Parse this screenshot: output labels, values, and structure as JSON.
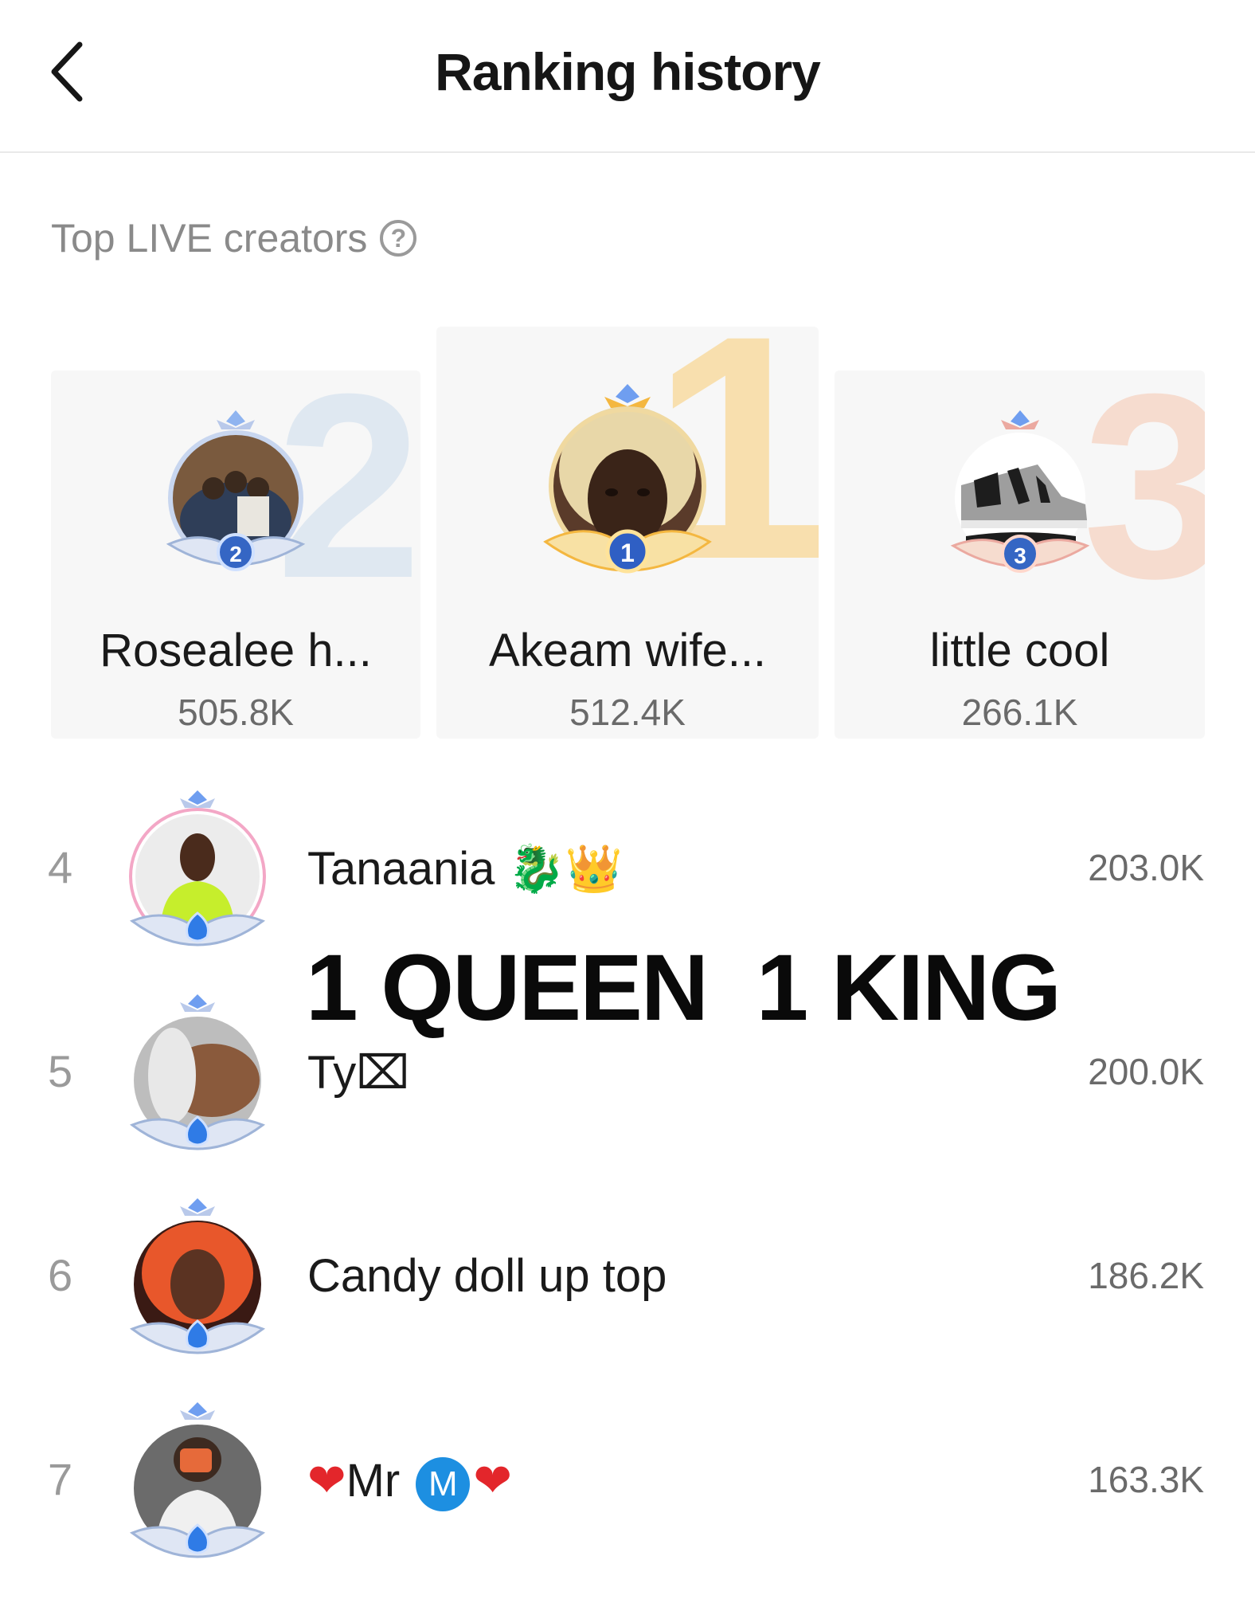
{
  "header": {
    "title": "Ranking history",
    "back_icon": "chevron-left-icon"
  },
  "section": {
    "label": "Top LIVE creators",
    "help_icon": "question-circle-icon"
  },
  "podium": [
    {
      "rank": "2",
      "name": "Rosealee h...",
      "score": "505.8K"
    },
    {
      "rank": "1",
      "name": "Akeam wife...",
      "score": "512.4K"
    },
    {
      "rank": "3",
      "name": "little cool",
      "score": "266.1K"
    }
  ],
  "list": [
    {
      "rank": "4",
      "name": "Tanaania",
      "emoji": "🐉👑",
      "score": "203.0K"
    },
    {
      "rank": "5",
      "name": "Ty",
      "emoji": "⌧",
      "score": "200.0K"
    },
    {
      "rank": "6",
      "name": "Candy doll up top",
      "emoji": "",
      "score": "186.2K"
    },
    {
      "rank": "7",
      "name": "Mr",
      "prefix": "❤",
      "badge": "M",
      "suffix": "❤",
      "score": "163.3K"
    }
  ],
  "overlay_text": "1 QUEEN  1 KING",
  "colors": {
    "gold": "#f4b740",
    "silver": "#9fb4d8",
    "bronze": "#eba9a0",
    "blue_badge": "#1d8fe1",
    "heart": "#e3262b"
  }
}
